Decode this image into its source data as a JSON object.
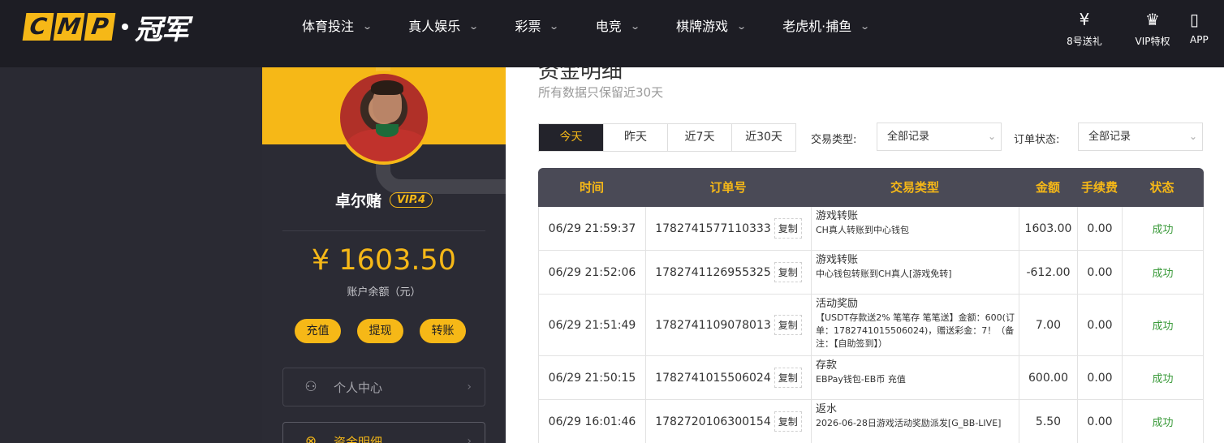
{
  "brand": {
    "logo_letters": [
      "C",
      "M",
      "P"
    ],
    "logo_cn": "冠军",
    "accent": "#f6b817",
    "nav_bg": "#1d1d24"
  },
  "nav": [
    {
      "label": "体育投注"
    },
    {
      "label": "真人娱乐"
    },
    {
      "label": "彩票"
    },
    {
      "label": "电竞"
    },
    {
      "label": "棋牌游戏"
    },
    {
      "label": "老虎机·捕鱼"
    }
  ],
  "top_icons": [
    {
      "icon": "gift-yen-icon",
      "label": "8号送礼"
    },
    {
      "icon": "crown-icon",
      "label": "VIP特权"
    },
    {
      "icon": "phone-icon",
      "label": "APP"
    }
  ],
  "profile": {
    "username": "卓尔赌",
    "vip": "VIP.4",
    "balance": "¥ 1603.50",
    "balance_label": "账户余额（元）",
    "actions": [
      "充值",
      "提现",
      "转账"
    ],
    "menu": [
      {
        "icon": "user-icon",
        "label": "个人中心",
        "active": false
      },
      {
        "icon": "yen-coin-icon",
        "label": "资金明细",
        "active": true
      }
    ]
  },
  "main": {
    "title": "资金明细",
    "subtitle": "所有数据只保留近30天",
    "date_tabs": [
      "今天",
      "昨天",
      "近7天",
      "近30天"
    ],
    "filters": {
      "type_label": "交易类型:",
      "type_value": "全部记录",
      "status_label": "订单状态:",
      "status_value": "全部记录"
    },
    "table": {
      "columns": [
        "时间",
        "订单号",
        "交易类型",
        "金额",
        "手续费",
        "状态"
      ],
      "copy_label": "复制",
      "rows": [
        {
          "time": "06/29 21:59:37",
          "order": "1782741577110333",
          "type_title": "游戏转账",
          "type_desc": "CH真人转账到中心钱包",
          "amount": "1603.00",
          "fee": "0.00",
          "status": "成功"
        },
        {
          "time": "06/29 21:52:06",
          "order": "1782741126955325",
          "type_title": "游戏转账",
          "type_desc": "中心钱包转账到CH真人[游戏免转]",
          "amount": "-612.00",
          "fee": "0.00",
          "status": "成功"
        },
        {
          "time": "06/29 21:51:49",
          "order": "1782741109078013",
          "type_title": "活动奖励",
          "type_desc": "【USDT存款送2% 笔笔存 笔笔送】金额：600(订单：1782741015506024)，赠送彩金：7！（备注：【自助签到】）",
          "amount": "7.00",
          "fee": "0.00",
          "status": "成功"
        },
        {
          "time": "06/29 21:50:15",
          "order": "1782741015506024",
          "type_title": "存款",
          "type_desc": "EBPay钱包-EB币 充值",
          "amount": "600.00",
          "fee": "0.00",
          "status": "成功"
        },
        {
          "time": "06/29 16:01:46",
          "order": "1782720106300154",
          "type_title": "返水",
          "type_desc": "2026-06-28日游戏活动奖励派发[G_BB-LIVE]",
          "amount": "5.50",
          "fee": "0.00",
          "status": "成功"
        }
      ]
    }
  }
}
